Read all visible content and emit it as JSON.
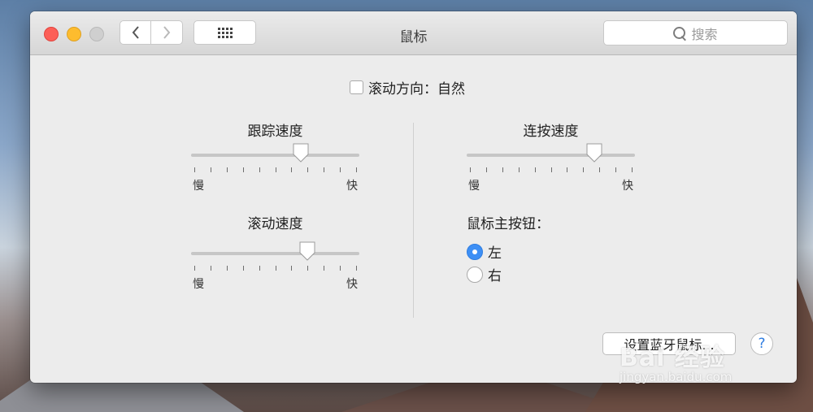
{
  "window": {
    "title": "鼠标",
    "search_placeholder": "搜索",
    "nav": {
      "back_icon": "chevron-left-icon",
      "forward_icon": "chevron-right-icon",
      "grid_icon": "grid-icon"
    }
  },
  "scroll_direction": {
    "label": "滚动方向：自然",
    "checked": false
  },
  "tracking_speed": {
    "label": "跟踪速度",
    "slow": "慢",
    "fast": "快",
    "value": 0.65
  },
  "scroll_speed": {
    "label": "滚动速度",
    "slow": "慢",
    "fast": "快",
    "value": 0.69
  },
  "double_click_speed": {
    "label": "连按速度",
    "slow": "慢",
    "fast": "快",
    "value": 0.76
  },
  "primary_button": {
    "label": "鼠标主按钮：",
    "options": [
      {
        "label": "左",
        "selected": true
      },
      {
        "label": "右",
        "selected": false
      }
    ]
  },
  "buttons": {
    "bluetooth_setup": "设置蓝牙鼠标...",
    "help": "?"
  },
  "watermark": {
    "brand": "Bai 经验",
    "url": "jingyan.baidu.com"
  },
  "colors": {
    "close": "#fc5f57",
    "minimize": "#fdbc2e",
    "accent": "#3d8ff5"
  }
}
